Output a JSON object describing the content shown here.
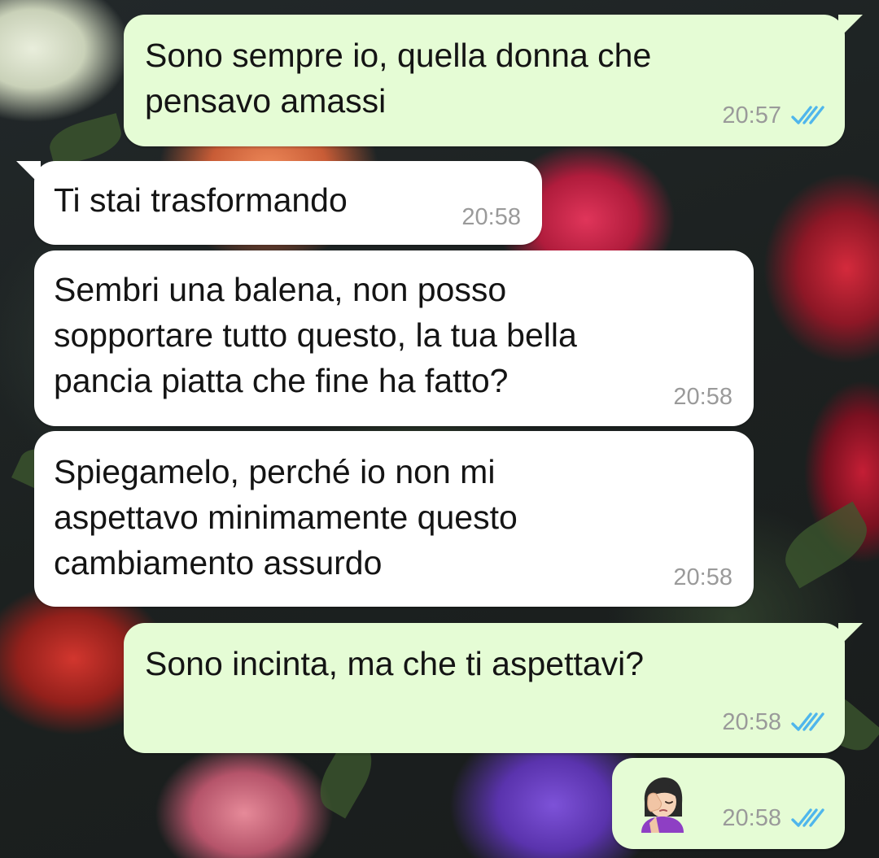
{
  "messages": [
    {
      "direction": "outgoing",
      "text": "Sono sempre io, quella donna che\npensavo amassi",
      "time": "20:57",
      "status": "read-double-check-icon"
    },
    {
      "direction": "incoming",
      "text": "Ti stai trasformando",
      "time": "20:58"
    },
    {
      "direction": "incoming",
      "text": "Sembri una balena, non posso\nsopportare tutto questo, la tua bella\npancia piatta che fine ha fatto?",
      "time": "20:58"
    },
    {
      "direction": "incoming",
      "text": "Spiegamelo, perché io non mi\naspettavo minimamente questo\ncambiamento assurdo",
      "time": "20:58"
    },
    {
      "direction": "outgoing",
      "text": "Sono incinta, ma che ti aspettavi?",
      "time": "20:58",
      "status": "read-double-check-icon"
    },
    {
      "direction": "outgoing",
      "emoji": "face-palm-woman-emoji",
      "time": "20:58",
      "status": "read-double-check-icon"
    }
  ],
  "colors": {
    "outgoing_bubble": "#e5fcd5",
    "incoming_bubble": "#ffffff",
    "timestamp": "#9a9a9a",
    "read_ticks": "#4fb6ec"
  }
}
